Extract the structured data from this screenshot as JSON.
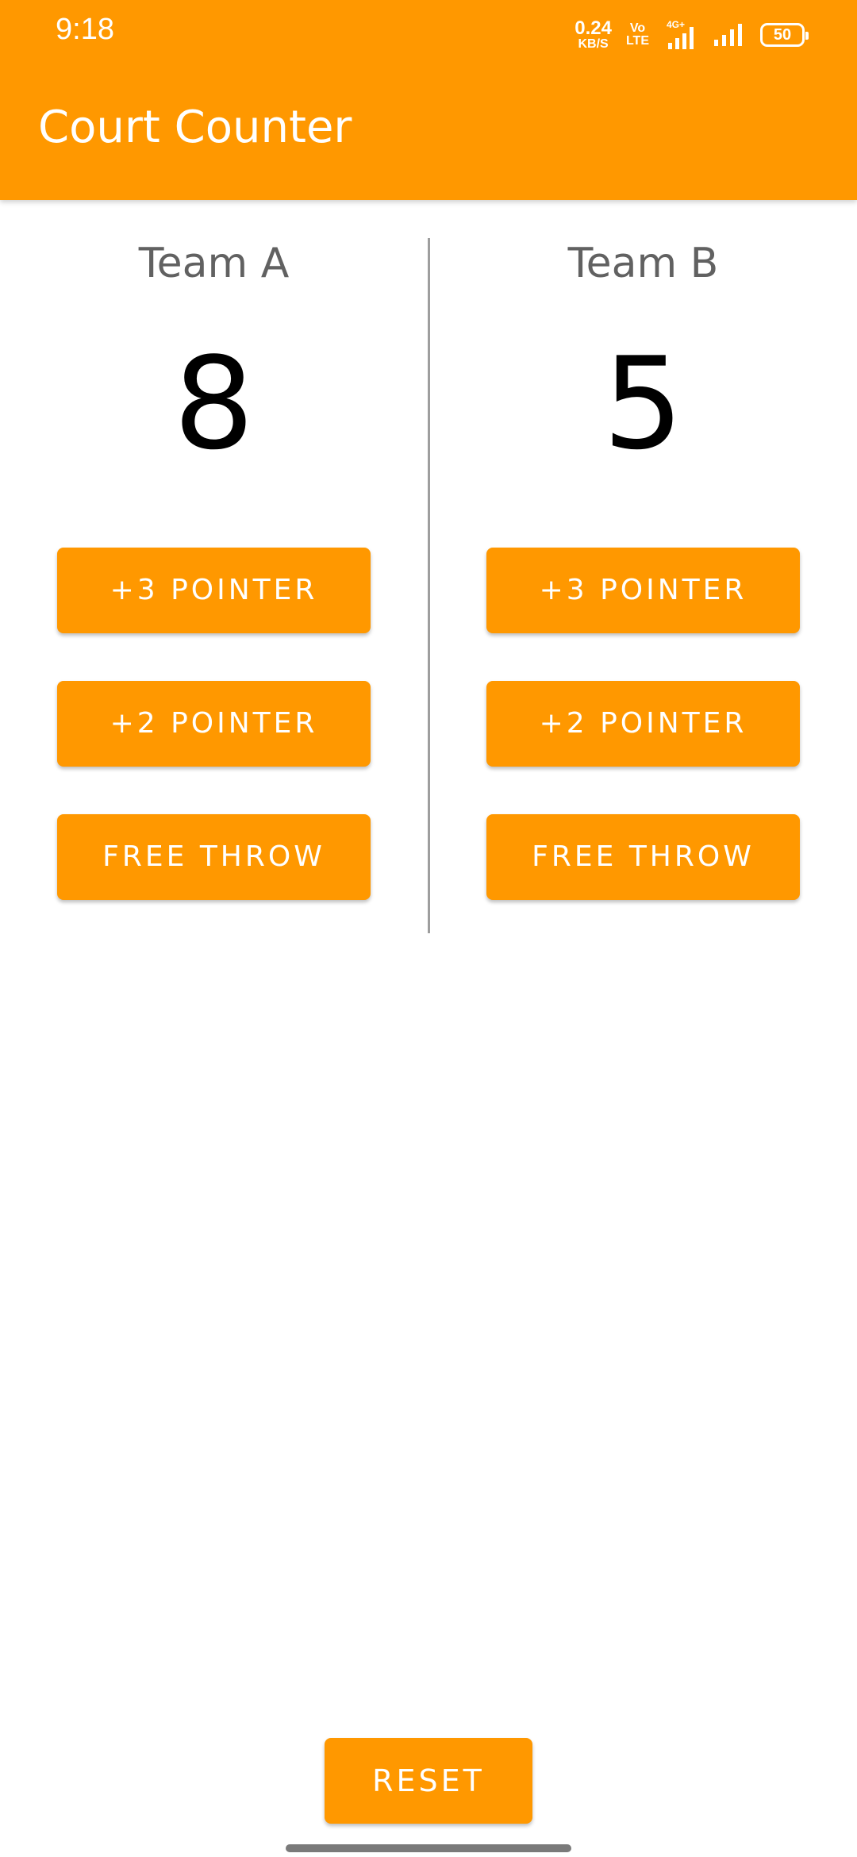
{
  "status_bar": {
    "time": "9:18",
    "net_speed_value": "0.24",
    "net_speed_unit": "KB/S",
    "volte_top": "Vo",
    "volte_bottom": "LTE",
    "network_type": "4G+",
    "battery": "50"
  },
  "app_bar": {
    "title": "Court Counter"
  },
  "team_a": {
    "name": "Team A",
    "score": "8",
    "buttons": {
      "three": "+3 POINTER",
      "two": "+2 POINTER",
      "free": "FREE THROW"
    }
  },
  "team_b": {
    "name": "Team B",
    "score": "5",
    "buttons": {
      "three": "+3 POINTER",
      "two": "+2 POINTER",
      "free": "FREE THROW"
    }
  },
  "reset": {
    "label": "RESET"
  },
  "colors": {
    "accent": "#ff9800",
    "team_name": "#616161",
    "score": "#000000",
    "divider": "#9e9e9e"
  }
}
